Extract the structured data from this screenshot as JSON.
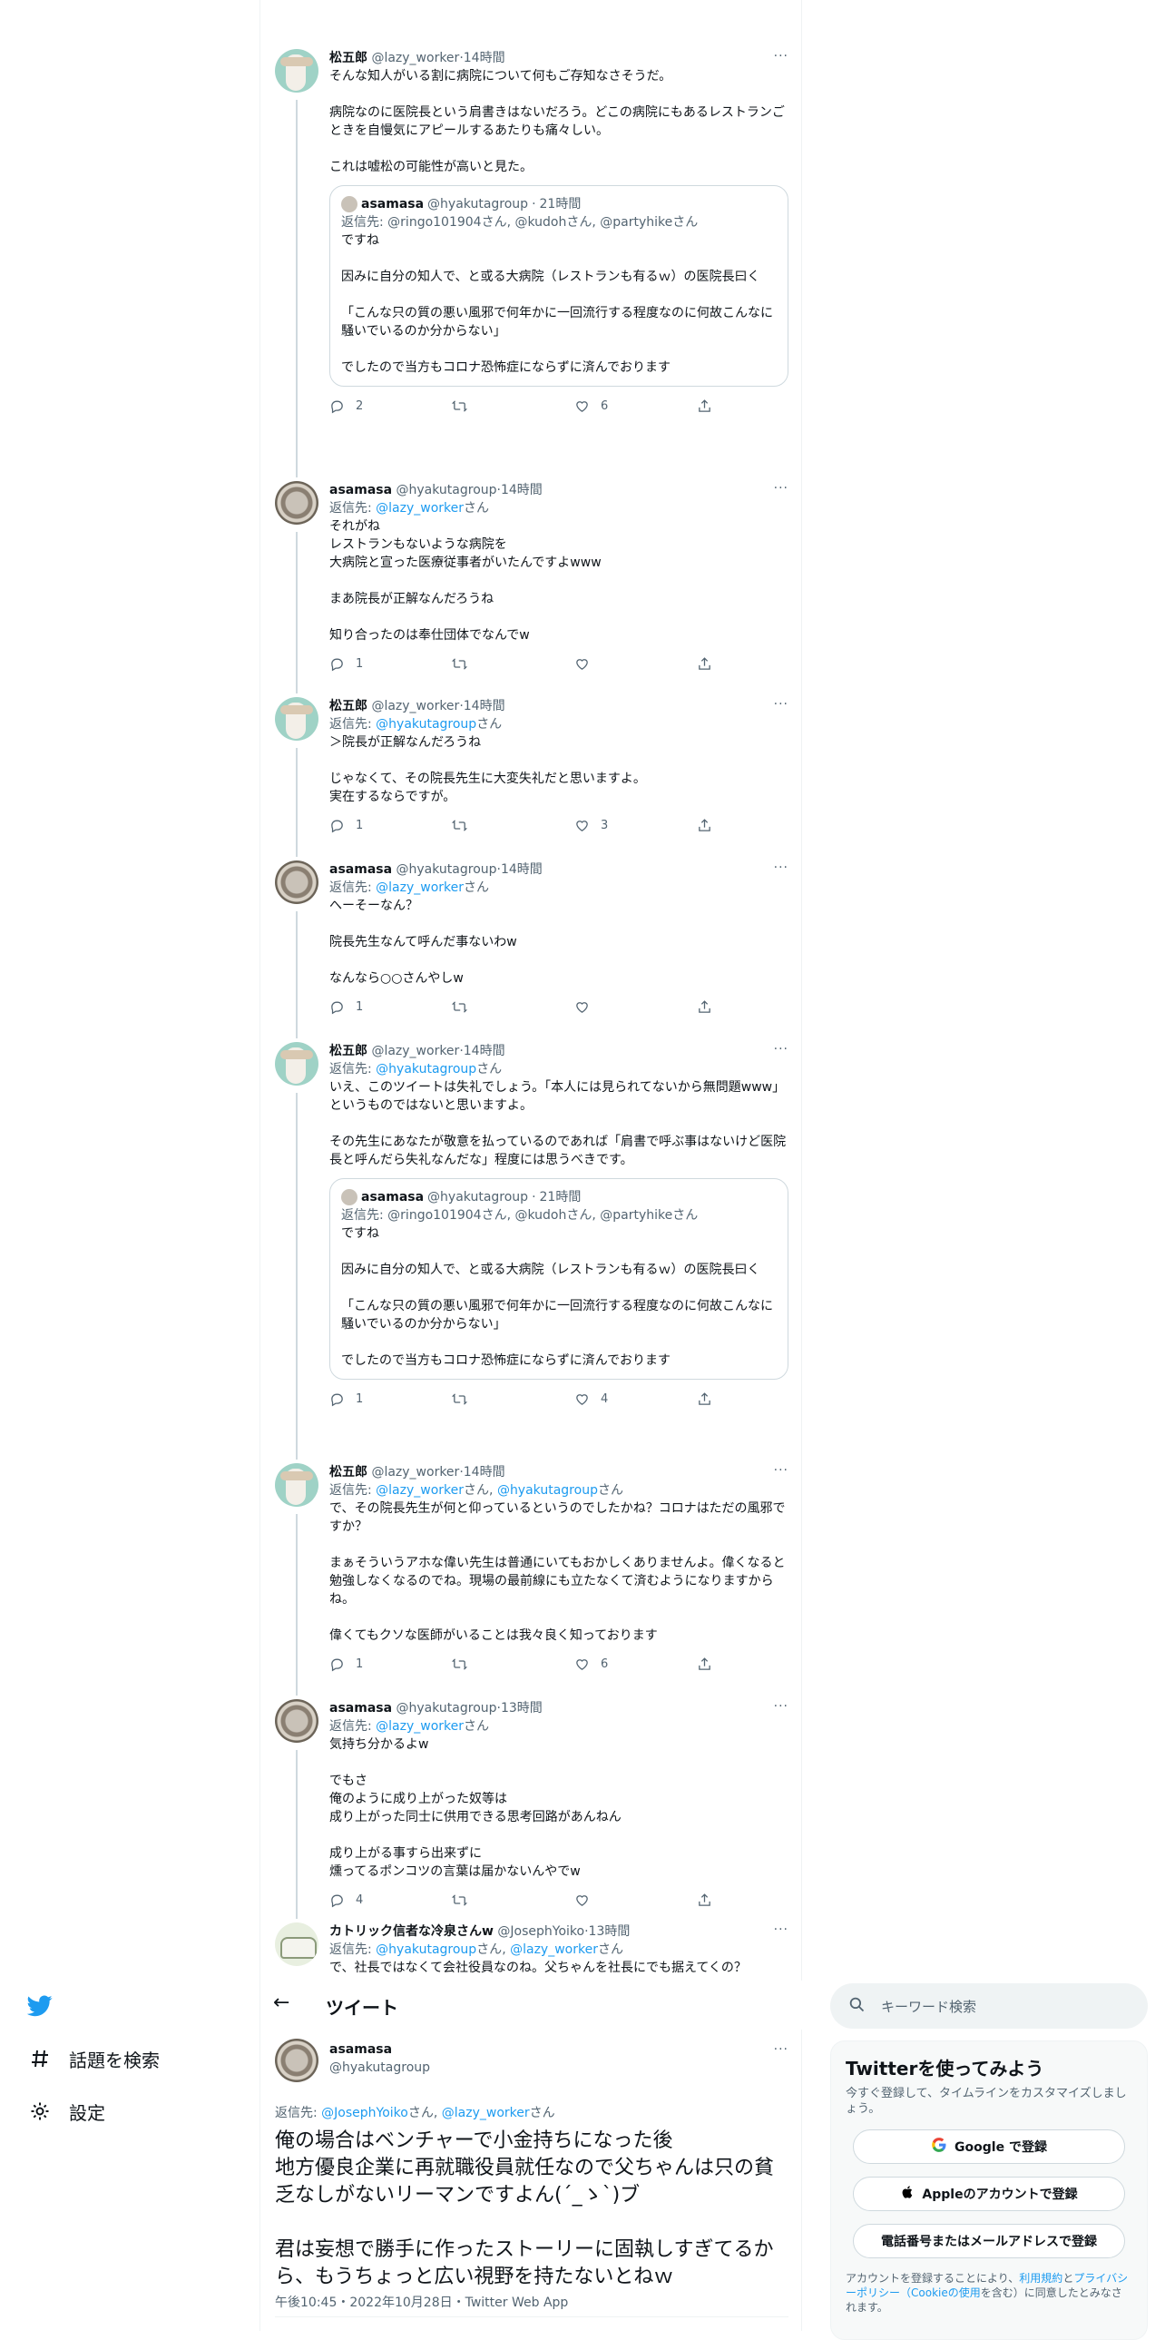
{
  "thread": [
    {
      "author": "松五郎",
      "handle": "@lazy_worker",
      "time": "14時間",
      "reply_prefix": "",
      "reply_to": [],
      "text": "そんな知人がいる割に病院について何もご存知なさそうだ。\n\n病院なのに医院長という肩書きはないだろう。どこの病院にもあるレストランごときを自慢気にアピールするあたりも痛々しい。\n\nこれは嘘松の可能性が高いと見た。",
      "quote": {
        "author": "asamasa",
        "handle": "@hyakutagroup",
        "time": "21時間",
        "reply_prefix": "返信先: ",
        "reply_to": "@ringo101904さん, @kudohさん, @partyhikeさん",
        "text": "ですね\n\n因みに自分の知人で、と或る大病院（レストランも有るｗ）の医院長曰く\n\n「こんな只の質の悪い風邪で何年かに一回流行する程度なのに何故こんなに騒いでいるのか分からない」\n\nでしたので当方もコロナ恐怖症にならずに済んでおります"
      },
      "replies": "2",
      "retweets": "",
      "likes": "6"
    },
    {
      "author": "asamasa",
      "handle": "@hyakutagroup",
      "time": "14時間",
      "reply_prefix": "返信先: ",
      "reply_to": [
        "@lazy_worker"
      ],
      "reply_suffix": "さん",
      "text": "それがね\nレストランもないような病院を\n大病院と宣った医療従事者がいたんですよwww\n\nまあ院長が正解なんだろうね\n\n知り合ったのは奉仕団体でなんでw",
      "replies": "1",
      "retweets": "",
      "likes": ""
    },
    {
      "author": "松五郎",
      "handle": "@lazy_worker",
      "time": "14時間",
      "reply_prefix": "返信先: ",
      "reply_to": [
        "@hyakutagroup"
      ],
      "reply_suffix": "さん",
      "text": "＞院長が正解なんだろうね\n\nじゃなくて、その院長先生に大変失礼だと思いますよ。\n実在するならですが。",
      "replies": "1",
      "retweets": "",
      "likes": "3"
    },
    {
      "author": "asamasa",
      "handle": "@hyakutagroup",
      "time": "14時間",
      "reply_prefix": "返信先: ",
      "reply_to": [
        "@lazy_worker"
      ],
      "reply_suffix": "さん",
      "text": "へーそーなん？\n\n院長先生なんて呼んだ事ないわw\n\nなんなら○○さんやしw",
      "replies": "1",
      "retweets": "",
      "likes": ""
    },
    {
      "author": "松五郎",
      "handle": "@lazy_worker",
      "time": "14時間",
      "reply_prefix": "返信先: ",
      "reply_to": [
        "@hyakutagroup"
      ],
      "reply_suffix": "さん",
      "text": "いえ、このツイートは失礼でしょう。「本人には見られてないから無問題www」というものではないと思いますよ。\n\nその先生にあなたが敬意を払っているのであれば「肩書で呼ぶ事はないけど医院長と呼んだら失礼なんだな」程度には思うべきです。",
      "quote": {
        "author": "asamasa",
        "handle": "@hyakutagroup",
        "time": "21時間",
        "reply_prefix": "返信先: ",
        "reply_to": "@ringo101904さん, @kudohさん, @partyhikeさん",
        "text": "ですね\n\n因みに自分の知人で、と或る大病院（レストランも有るｗ）の医院長曰く\n\n「こんな只の質の悪い風邪で何年かに一回流行する程度なのに何故こんなに騒いでいるのか分からない」\n\nでしたので当方もコロナ恐怖症にならずに済んでおります"
      },
      "replies": "1",
      "retweets": "",
      "likes": "4"
    },
    {
      "author": "松五郎",
      "handle": "@lazy_worker",
      "time": "14時間",
      "reply_prefix": "返信先: ",
      "reply_to": [
        "@lazy_worker",
        "@hyakutagroup"
      ],
      "reply_suffix": "さん",
      "text": "で、その院長先生が何と仰っているというのでしたかね？コロナはただの風邪ですか？\n\nまぁそういうアホな偉い先生は普通にいてもおかしくありませんよ。偉くなると勉強しなくなるのでね。現場の最前線にも立たなくて済むようになりますからね。\n\n偉くてもクソな医師がいることは我々良く知っております",
      "replies": "1",
      "retweets": "",
      "likes": "6"
    },
    {
      "author": "asamasa",
      "handle": "@hyakutagroup",
      "time": "13時間",
      "reply_prefix": "返信先: ",
      "reply_to": [
        "@lazy_worker"
      ],
      "reply_suffix": "さん",
      "text": "気持ち分かるよw\n\nでもさ\n俺のように成り上がった奴等は\n成り上がった同士に供用できる思考回路があんねん\n\n成り上がる事すら出来ずに\n燻ってるポンコツの言葉は届かないんやでw",
      "replies": "4",
      "retweets": "",
      "likes": ""
    },
    {
      "author": "カトリック信者な冷泉さんw",
      "handle": "@JosephYoiko",
      "time": "13時間",
      "reply_prefix": "返信先: ",
      "reply_to": [
        "@hyakutagroup",
        "@lazy_worker"
      ],
      "reply_suffix": "さん",
      "text": "で、社長ではなくて会社役員なのね。父ちゃんを社長にでも据えてくの？",
      "replies": "",
      "retweets": "",
      "likes": ""
    }
  ],
  "header": {
    "back": "←",
    "title": "ツイート"
  },
  "main_tweet": {
    "author": "asamasa",
    "handle": "@hyakutagroup",
    "reply_prefix": "返信先: ",
    "reply_to_1": "@JosephYoiko",
    "mid": "さん, ",
    "reply_to_2": "@lazy_worker",
    "suffix": "さん",
    "text": "俺の場合はベンチャーで小金持ちになった後\n地方優良企業に再就職役員就任なので父ちゃんは只の貧乏なしがないリーマンですよん(´_ゝ`)ブ\n\n君は妄想で勝手に作ったストーリーに固執しすぎてるから、もうちょっと広い視野を持たないとねｗ",
    "meta": "午後10:45・2022年10月28日・Twitter Web App"
  },
  "nav": [
    {
      "label": "話題を検索",
      "icon": "hashtag-icon"
    },
    {
      "label": "設定",
      "icon": "gear-icon"
    }
  ],
  "search": {
    "placeholder": "キーワード検索"
  },
  "signup": {
    "title": "Twitterを使ってみよう",
    "subtitle": "今すぐ登録して、タイムラインをカスタマイズしましょう。",
    "google": "Google で登録",
    "apple": "Appleのアカウントで登録",
    "phone": "電話番号またはメールアドレスで登録",
    "legal_1": "アカウントを登録することにより、",
    "terms": "利用規約",
    "and": "と",
    "privacy": "プライバシーポリシー（Cookieの使用",
    "legal_2": "を含む）に同意したとみなされます。"
  },
  "more_label": "···",
  "colors": {
    "accent": "#1d9bf0",
    "text": "#0f1419",
    "muted": "#536471",
    "border": "#cfd9de"
  }
}
